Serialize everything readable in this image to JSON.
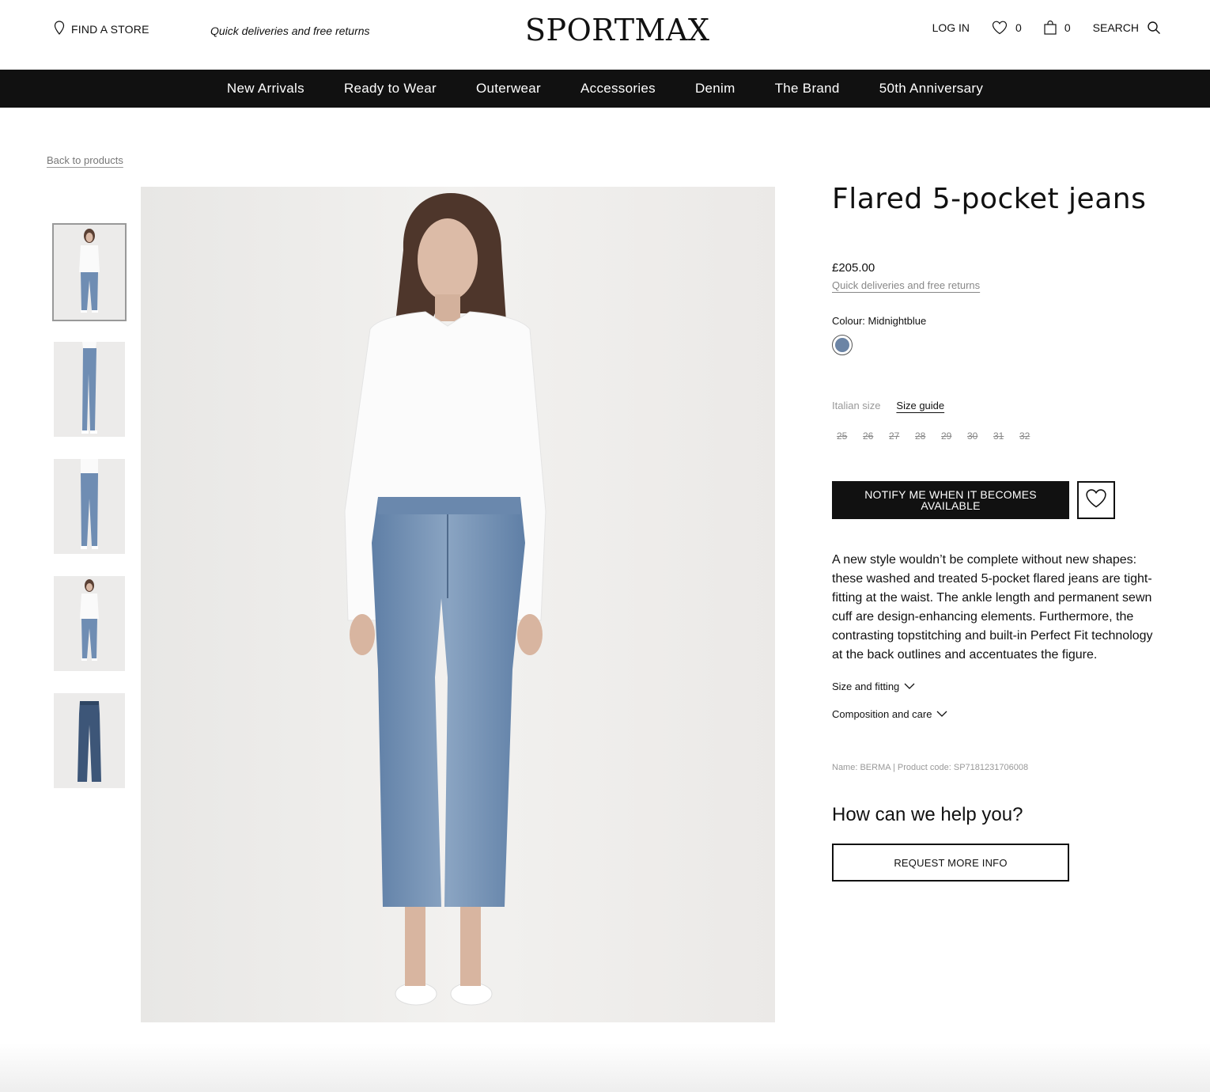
{
  "header": {
    "find_store": "FIND A STORE",
    "promo": "Quick deliveries and free returns",
    "logo": "SPORTMAX",
    "login": "LOG IN",
    "wishlist_count": "0",
    "cart_count": "0",
    "search": "SEARCH"
  },
  "nav": {
    "items": [
      "New Arrivals",
      "Ready to Wear",
      "Outerwear",
      "Accessories",
      "Denim",
      "The Brand",
      "50th Anniversary"
    ]
  },
  "breadcrumb": {
    "back": "Back to products"
  },
  "product": {
    "title": "Flared 5-pocket jeans",
    "price": "£205.00",
    "delivery_link": "Quick deliveries and free returns",
    "colour_label": "Colour: Midnightblue",
    "swatch_color": "#6b84a5",
    "size_label": "Italian size",
    "size_guide": "Size guide",
    "sizes": [
      "25",
      "26",
      "27",
      "28",
      "29",
      "30",
      "31",
      "32"
    ],
    "notify": "NOTIFY ME WHEN IT BECOMES AVAILABLE",
    "description": "A new style wouldn’t be complete without new shapes: these washed and treated 5-pocket flared jeans are tight-fitting at the waist. The ankle length and permanent sewn cuff are design-enhancing elements. Furthermore, the contrasting topstitching and built-in Perfect Fit technology at the back outlines and accentuates the figure.",
    "accordion_size": "Size and fitting",
    "accordion_comp": "Composition and care",
    "meta": "Name: BERMA | Product code: SP7181231706008"
  },
  "help": {
    "title": "How can we help you?",
    "request": "REQUEST MORE INFO"
  },
  "colors": {
    "denim": "#6b84a5",
    "nav_bg": "#111111"
  }
}
